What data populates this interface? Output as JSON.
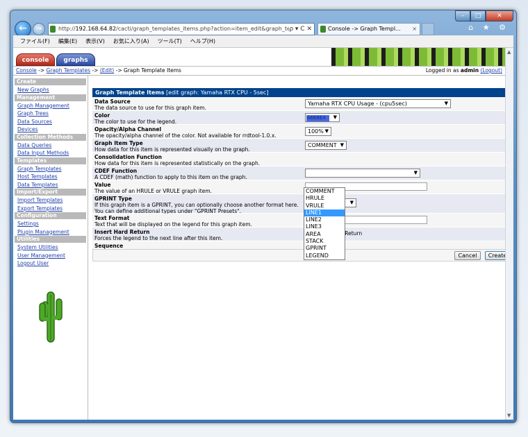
{
  "browser": {
    "url_protocol": "http://",
    "url_domain": "192.168.64.82",
    "url_path": "/cacti/graph_templates_items.php?action=item_edit&graph_tem",
    "url_controls": "ρ ▾ C ✕",
    "tab_title": "Console -> Graph Templ...",
    "tab_close": "×",
    "tools_icons": "⌂ ★ ⚙",
    "menu": [
      "ファイル(F)",
      "編集(E)",
      "表示(V)",
      "お気に入り(A)",
      "ツール(T)",
      "ヘルプ(H)"
    ]
  },
  "window_controls": {
    "min": "–",
    "max": "□",
    "close": "✕"
  },
  "cacti_tabs": {
    "console": "console",
    "graphs": "graphs"
  },
  "breadcrumb": {
    "console": "Console",
    "sep1": " -> ",
    "graph_templates": "Graph Templates",
    "sep2": " -> ",
    "edit": "(Edit)",
    "sep3": " -> Graph Template Items",
    "logged_in_prefix": "Logged in as ",
    "user": "admin",
    "logout": "(Logout)"
  },
  "sidebar": [
    {
      "type": "header",
      "label": "Create"
    },
    {
      "type": "item",
      "label": "New Graphs"
    },
    {
      "type": "header",
      "label": "Management"
    },
    {
      "type": "item",
      "label": "Graph Management"
    },
    {
      "type": "item",
      "label": "Graph Trees"
    },
    {
      "type": "item",
      "label": "Data Sources"
    },
    {
      "type": "item",
      "label": "Devices"
    },
    {
      "type": "header",
      "label": "Collection Methods"
    },
    {
      "type": "item",
      "label": "Data Queries"
    },
    {
      "type": "item",
      "label": "Data Input Methods"
    },
    {
      "type": "header",
      "label": "Templates"
    },
    {
      "type": "item",
      "label": "Graph Templates"
    },
    {
      "type": "item",
      "label": "Host Templates"
    },
    {
      "type": "item",
      "label": "Data Templates"
    },
    {
      "type": "header",
      "label": "Import/Export"
    },
    {
      "type": "item",
      "label": "Import Templates"
    },
    {
      "type": "item",
      "label": "Export Templates"
    },
    {
      "type": "header",
      "label": "Configuration"
    },
    {
      "type": "item",
      "label": "Settings"
    },
    {
      "type": "item",
      "label": "Plugin Management"
    },
    {
      "type": "header",
      "label": "Utilities"
    },
    {
      "type": "item",
      "label": "System Utilities"
    },
    {
      "type": "item",
      "label": "User Management"
    },
    {
      "type": "item",
      "label": "Logout User"
    }
  ],
  "form": {
    "title": "Graph Template Items",
    "subtitle": " [edit graph: Yamaha RTX CPU - 5sec]",
    "fields": {
      "data_source": {
        "label": "Data Source",
        "desc": "The data source to use for this graph item.",
        "value": "Yamaha RTX CPU Usage - (cpu5sec)"
      },
      "color": {
        "label": "Color",
        "desc": "The color to use for the legend.",
        "value": "4668E4",
        "swatch": "#4668E4"
      },
      "opacity": {
        "label": "Opacity/Alpha Channel",
        "desc": "The opacity/alpha channel of the color. Not available for rrdtool-1.0.x.",
        "value": "100%"
      },
      "item_type": {
        "label": "Graph Item Type",
        "desc": "How data for this item is represented visually on the graph.",
        "value": "COMMENT"
      },
      "consolidation": {
        "label": "Consolidation Function",
        "desc": "How data for this item is represented statistically on the graph."
      },
      "cdef": {
        "label": "CDEF Function",
        "desc": "A CDEF (math) function to apply to this item on the graph."
      },
      "value": {
        "label": "Value",
        "desc": "The value of an HRULE or VRULE graph item."
      },
      "gprint": {
        "label": "GPRINT Type",
        "desc1": "If this graph item is a GPRINT, you can optionally choose another format here.",
        "desc2": "You can define additional types under \"GPRINT Presets\"."
      },
      "text_format": {
        "label": "Text Format",
        "desc": "Text that will be displayed on the legend for this graph item."
      },
      "hard_return": {
        "label": "Insert Hard Return",
        "desc": "Forces the legend to the next line after this item.",
        "checkbox_label": "Insert Hard Return"
      },
      "sequence": {
        "label": "Sequence"
      }
    },
    "dropdown_options": [
      "COMMENT",
      "HRULE",
      "VRULE",
      "LINE1",
      "LINE2",
      "LINE3",
      "AREA",
      "STACK",
      "GPRINT",
      "LEGEND"
    ],
    "dropdown_highlighted": "LINE1",
    "cancel": "Cancel",
    "create": "Create"
  }
}
